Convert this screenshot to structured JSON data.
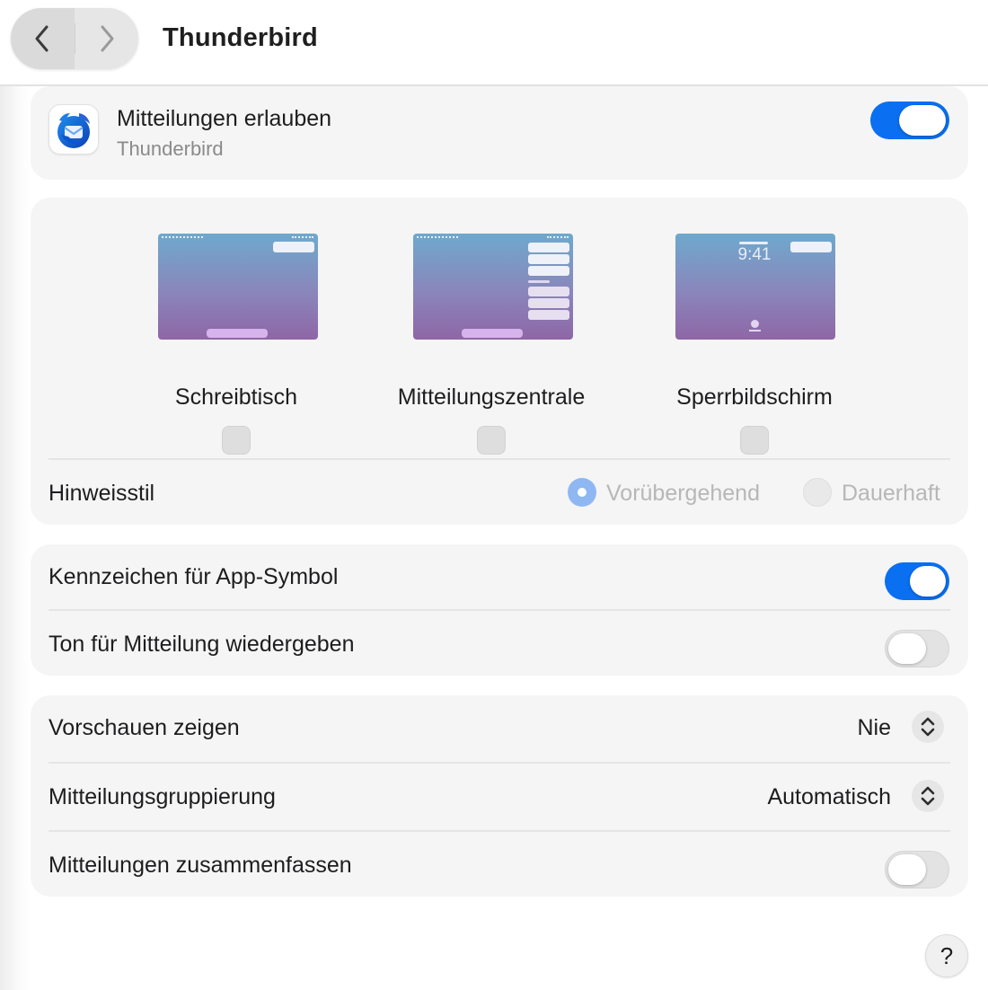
{
  "window": {
    "title": "Thunderbird"
  },
  "app": {
    "name": "Thunderbird",
    "allow_label": "Mitteilungen erlauben",
    "allow_enabled": true
  },
  "alert_styles": {
    "options": [
      {
        "label": "Schreibtisch",
        "checked": false
      },
      {
        "label": "Mitteilungszentrale",
        "checked": false
      },
      {
        "label": "Sperrbildschirm",
        "checked": false
      }
    ],
    "lock_clock": "9:41"
  },
  "hint_style": {
    "label": "Hinweisstil",
    "options": [
      {
        "label": "Vorübergehend",
        "selected": true
      },
      {
        "label": "Dauerhaft",
        "selected": false
      }
    ]
  },
  "badges": {
    "label": "Kennzeichen für App-Symbol",
    "enabled": true
  },
  "sound": {
    "label": "Ton für Mitteilung wiedergeben",
    "enabled": false
  },
  "previews": {
    "label": "Vorschauen zeigen",
    "value": "Nie"
  },
  "grouping": {
    "label": "Mitteilungsgruppierung",
    "value": "Automatisch"
  },
  "summarize": {
    "label": "Mitteilungen zusammenfassen",
    "enabled": false
  },
  "help": {
    "label": "?"
  },
  "colors": {
    "accent": "#0a6ff0",
    "radio_selected": "#8fb8f2"
  }
}
